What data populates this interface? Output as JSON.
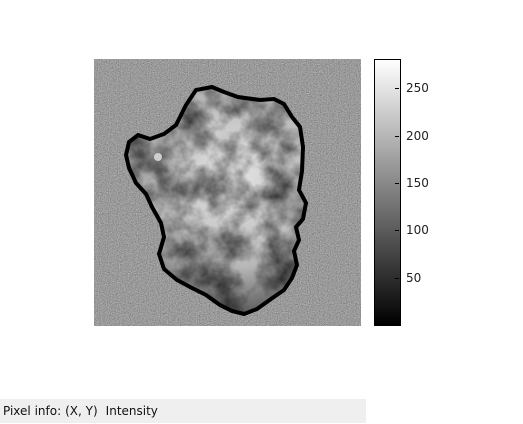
{
  "image": {
    "description_icon": "grayscale-intensity-image",
    "background_gray": "#7a7a7a"
  },
  "colorbar": {
    "range": [
      0,
      280
    ],
    "ticks": [
      {
        "value": 250,
        "label": "250"
      },
      {
        "value": 200,
        "label": "200"
      },
      {
        "value": 150,
        "label": "150"
      },
      {
        "value": 100,
        "label": "100"
      },
      {
        "value": 50,
        "label": "50"
      }
    ]
  },
  "status": {
    "pixel_info_label": "Pixel info:",
    "coords_label": "(X, Y)",
    "intensity_label": "Intensity"
  }
}
